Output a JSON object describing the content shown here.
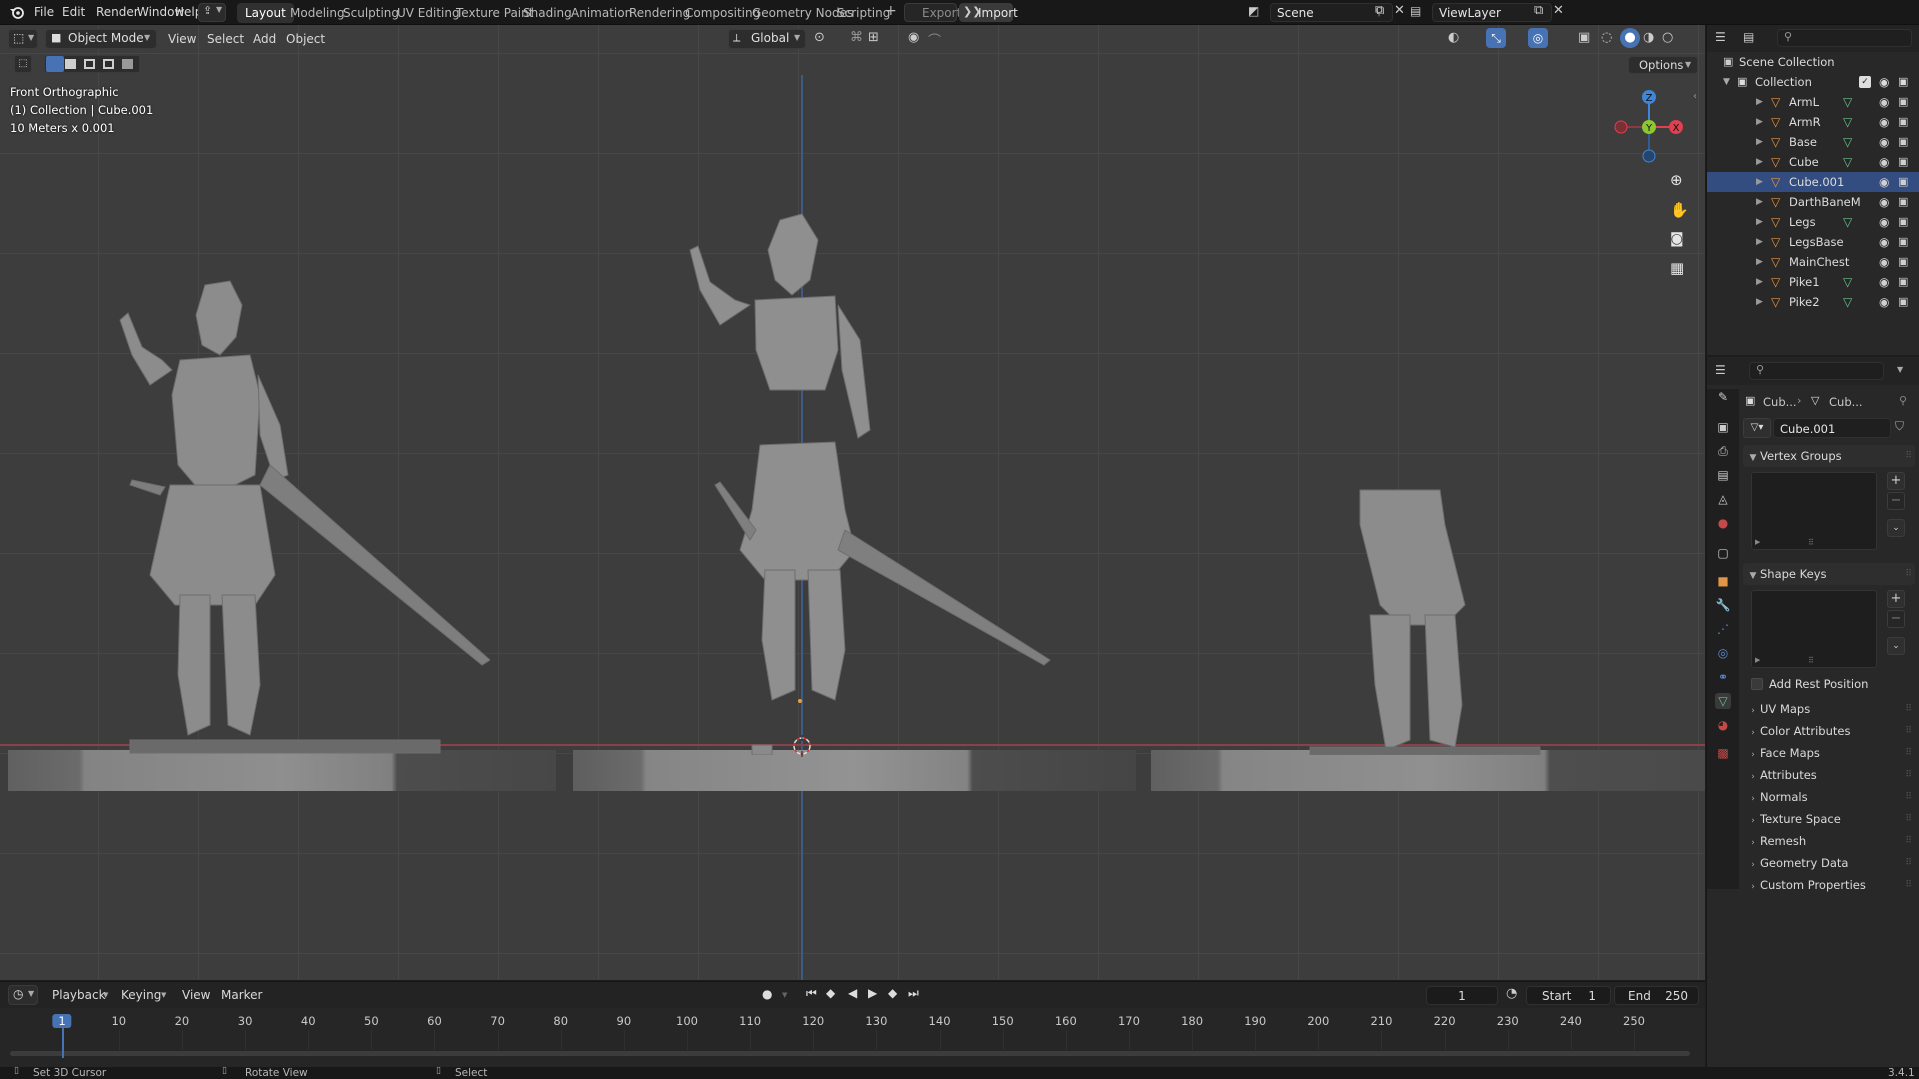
{
  "topbar": {
    "menus": [
      "File",
      "Edit",
      "Render",
      "Window",
      "Help"
    ],
    "workspaces": [
      "Layout",
      "Modeling",
      "Sculpting",
      "UV Editing",
      "Texture Paint",
      "Shading",
      "Animation",
      "Rendering",
      "Compositing",
      "Geometry Nodes",
      "Scripting"
    ],
    "active_workspace": "Layout",
    "export_label": "Export",
    "import_label": "Import",
    "scene_name": "Scene",
    "view_layer": "ViewLayer"
  },
  "viewport": {
    "mode": "Object Mode",
    "menus": [
      "View",
      "Select",
      "Add",
      "Object"
    ],
    "transform_orientation": "Global",
    "options_label": "Options",
    "overlay_lines": [
      "Front Orthographic",
      "(1) Collection | Cube.001",
      "10 Meters x 0.001"
    ],
    "gizmo_axes": {
      "z": "Z",
      "y": "Y",
      "x": "X"
    }
  },
  "outliner": {
    "root": "Scene Collection",
    "collection": "Collection",
    "items": [
      {
        "name": "ArmL",
        "modifier": true
      },
      {
        "name": "ArmR",
        "modifier": true
      },
      {
        "name": "Base",
        "modifier": true
      },
      {
        "name": "Cube",
        "modifier": true
      },
      {
        "name": "Cube.001",
        "modifier": false
      },
      {
        "name": "DarthBaneM",
        "modifier": false
      },
      {
        "name": "Legs",
        "modifier": true
      },
      {
        "name": "LegsBase",
        "modifier": false
      },
      {
        "name": "MainChest",
        "modifier": false
      },
      {
        "name": "Pike1",
        "modifier": true
      },
      {
        "name": "Pike2",
        "modifier": true
      }
    ]
  },
  "properties": {
    "breadcrumb_object": "Cub...",
    "breadcrumb_data": "Cub...",
    "mesh_name": "Cube.001",
    "panels_open": [
      "Vertex Groups",
      "Shape Keys"
    ],
    "add_rest_position": "Add Rest Position",
    "panels_closed": [
      "UV Maps",
      "Color Attributes",
      "Face Maps",
      "Attributes",
      "Normals",
      "Texture Space",
      "Remesh",
      "Geometry Data",
      "Custom Properties"
    ]
  },
  "timeline": {
    "menus": [
      "Playback",
      "Keying",
      "View",
      "Marker"
    ],
    "current_frame": "1",
    "start_label": "Start",
    "start_value": "1",
    "end_label": "End",
    "end_value": "250",
    "ticks": [
      "1",
      "10",
      "20",
      "30",
      "40",
      "50",
      "60",
      "70",
      "80",
      "90",
      "100",
      "110",
      "120",
      "130",
      "140",
      "150",
      "160",
      "170",
      "180",
      "190",
      "200",
      "210",
      "220",
      "230",
      "240",
      "250"
    ]
  },
  "statusbar": {
    "items": [
      "Set 3D Cursor",
      "Rotate View",
      "Select"
    ],
    "version": "3.4.1"
  },
  "colors": {
    "accent_blue": "#4772b3",
    "axis_x": "#e0404f",
    "axis_y": "#8ec630",
    "axis_z": "#3f86d8",
    "object_orange": "#e19548",
    "modifier_green": "#6ac08e"
  }
}
